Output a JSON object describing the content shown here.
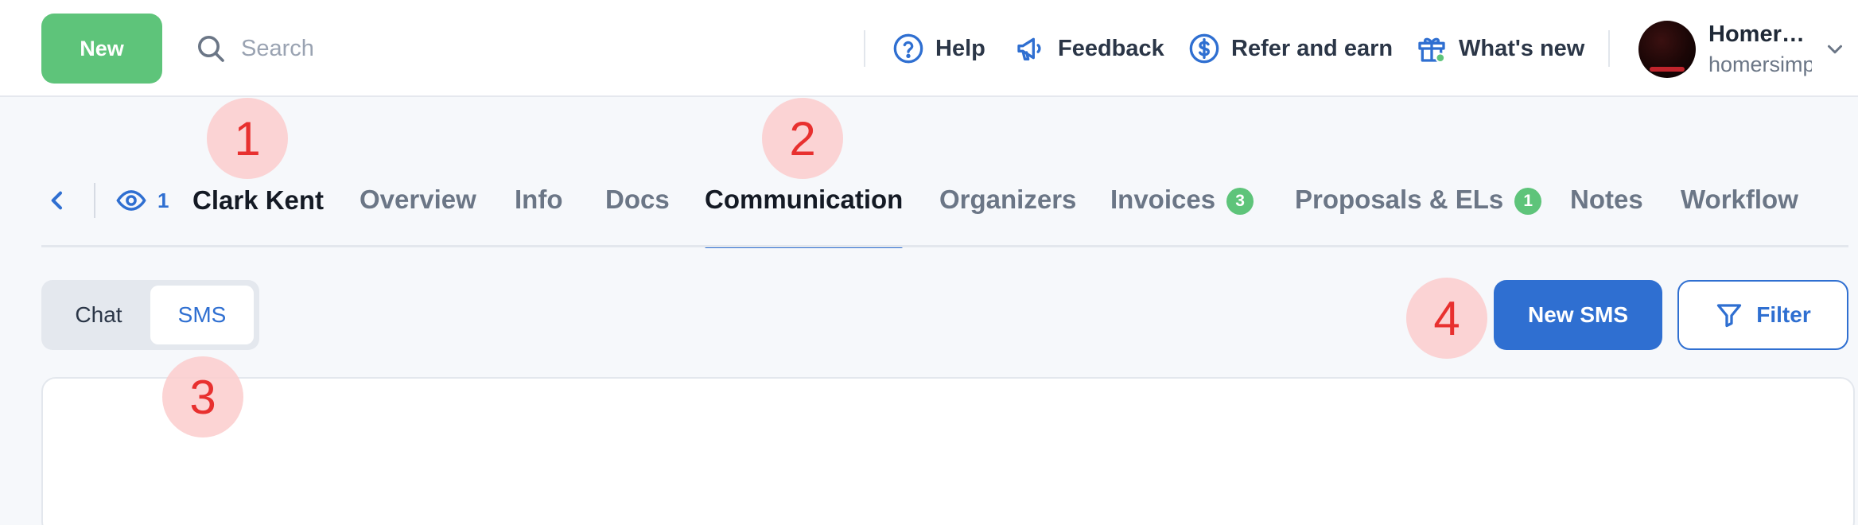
{
  "topbar": {
    "new_label": "New",
    "search_placeholder": "Search",
    "links": {
      "help": "Help",
      "feedback": "Feedback",
      "refer": "Refer and earn",
      "whats_new": "What's new"
    },
    "user": {
      "name": "Homer…",
      "email": "homersimp"
    }
  },
  "client": {
    "viewers_count": "1",
    "name": "Clark Kent"
  },
  "tabs": [
    {
      "label": "Overview"
    },
    {
      "label": "Info"
    },
    {
      "label": "Docs"
    },
    {
      "label": "Communication",
      "active": true
    },
    {
      "label": "Organizers"
    },
    {
      "label": "Invoices",
      "badge": "3"
    },
    {
      "label": "Proposals & ELs",
      "badge": "1"
    },
    {
      "label": "Notes"
    },
    {
      "label": "Workflow"
    }
  ],
  "segment": {
    "chat": "Chat",
    "sms": "SMS",
    "selected": "SMS"
  },
  "actions": {
    "new_sms": "New SMS",
    "filter": "Filter"
  },
  "annotations": [
    "1",
    "2",
    "3",
    "4"
  ],
  "colors": {
    "brand_green": "#5ec47a",
    "primary_blue": "#2f6fd1",
    "marker_red": "#e8302f",
    "marker_bg": "#fccdcd"
  }
}
